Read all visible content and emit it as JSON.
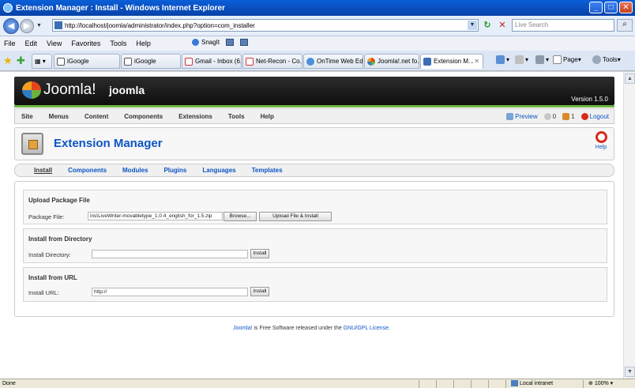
{
  "window": {
    "title": "Extension Manager : Install - Windows Internet Explorer"
  },
  "addressbar": {
    "url": "http://localhost/joomla/administrator/index.php?option=com_installer",
    "search_placeholder": "Live Search"
  },
  "menubar": {
    "items": [
      "File",
      "Edit",
      "View",
      "Favorites",
      "Tools",
      "Help"
    ],
    "snagit": "SnagIt"
  },
  "tabs": [
    "iGoogle",
    "iGoogle",
    "Gmail - Inbox (6...",
    "Net-Recon - Co...",
    "OnTime Web Edi...",
    "Joomla!.net fo...",
    "Extension M..."
  ],
  "ie_tools": {
    "page": "Page",
    "tools": "Tools"
  },
  "joomla": {
    "logo": "Joomla!",
    "site_name": "joomla",
    "version": "Version 1.5.0",
    "menu": [
      "Site",
      "Menus",
      "Content",
      "Components",
      "Extensions",
      "Tools",
      "Help"
    ],
    "preview": "Preview",
    "messages": "0",
    "users": "1",
    "logout": "Logout",
    "page_title": "Extension Manager",
    "help": "Help",
    "subnav": [
      "Install",
      "Components",
      "Modules",
      "Plugins",
      "Languages",
      "Templates"
    ],
    "upload": {
      "heading": "Upload Package File",
      "label": "Package File:",
      "value": "ins\\LiveWriter-movabletype_1.0.4_english_for_1.5.zip",
      "browse": "Browse...",
      "button": "Upload File & Install"
    },
    "directory": {
      "heading": "Install from Directory",
      "label": "Install Directory:",
      "value": "",
      "button": "Install"
    },
    "url": {
      "heading": "Install from URL",
      "label": "Install URL:",
      "value": "http://",
      "button": "Install"
    },
    "footer": {
      "brand": "Joomla!",
      "text": " is Free Software released under the ",
      "license": "GNU/GPL License."
    }
  },
  "statusbar": {
    "status": "Done",
    "zone": "Local intranet",
    "zoom": "100%"
  }
}
